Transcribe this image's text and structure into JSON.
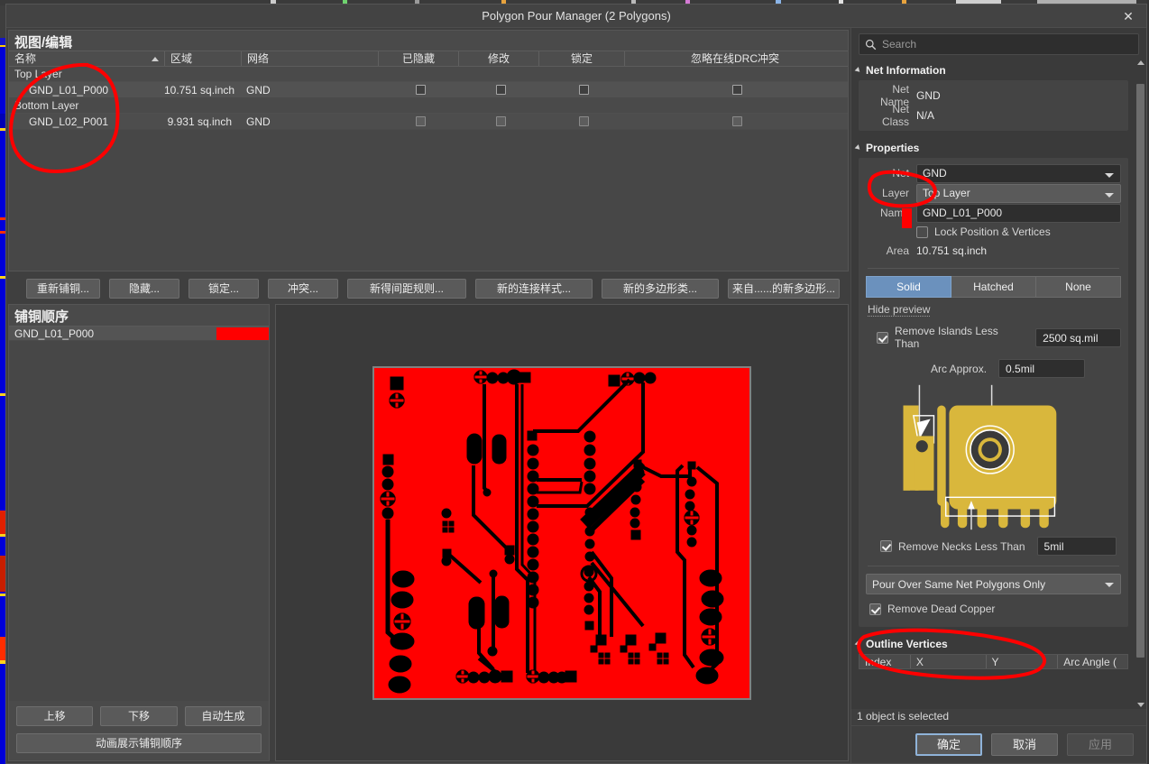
{
  "window": {
    "title": "Polygon Pour Manager (2 Polygons)",
    "close_icon": "close-icon"
  },
  "view_edit": {
    "heading": "视图/编辑",
    "columns": [
      "名称",
      "区域",
      "网络",
      "已隐藏",
      "修改",
      "锁定",
      "忽略在线DRC冲突"
    ],
    "groups": [
      {
        "layer": "Top Layer",
        "rows": [
          {
            "name": "GND_L01_P000",
            "area": "10.751 sq.inch",
            "net": "GND",
            "hidden": false,
            "modified": false,
            "locked": false,
            "ignore_drc": false
          }
        ]
      },
      {
        "layer": "Bottom Layer",
        "rows": [
          {
            "name": "GND_L02_P001",
            "area": "9.931 sq.inch",
            "net": "GND",
            "hidden": false,
            "modified": false,
            "locked": false,
            "ignore_drc": false
          }
        ]
      }
    ],
    "buttons": [
      "重新铺铜...",
      "隐藏...",
      "锁定...",
      "冲突...",
      "新得间距规则...",
      "新的连接样式...",
      "新的多边形类...",
      "来自......的新多边形..."
    ]
  },
  "pour_order": {
    "heading": "铺铜顺序",
    "items": [
      {
        "name": "GND_L01_P000",
        "color": "#ff0000"
      }
    ],
    "buttons": {
      "up": "上移",
      "down": "下移",
      "auto": "自动生成",
      "animate": "动画展示铺铜顺序"
    }
  },
  "preview": {
    "board_color": "#ff0000",
    "trace_color": "#000000",
    "background": "#808080"
  },
  "search": {
    "placeholder": "Search",
    "value": "",
    "icon": "search-icon"
  },
  "net_information": {
    "title": "Net Information",
    "net_name_label": "Net Name",
    "net_name_value": "GND",
    "net_class_label": "Net Class",
    "net_class_value": "N/A"
  },
  "properties": {
    "title": "Properties",
    "net_label": "Net",
    "net_value": "GND",
    "layer_label": "Layer",
    "layer_value": "Top Layer",
    "name_label": "Name",
    "name_value": "GND_L01_P000",
    "lock_label": "Lock Position & Vertices",
    "lock_checked": false,
    "area_label": "Area",
    "area_value": "10.751 sq.inch",
    "fill_modes": [
      "Solid",
      "Hatched",
      "None"
    ],
    "fill_mode_selected": "Solid",
    "hide_preview_label": "Hide preview",
    "remove_islands_label": "Remove Islands Less Than",
    "remove_islands_checked": true,
    "remove_islands_value": "2500 sq.mil",
    "arc_approx_label": "Arc Approx.",
    "arc_approx_value": "0.5mil",
    "remove_necks_label": "Remove Necks Less Than",
    "remove_necks_checked": true,
    "remove_necks_value": "5mil",
    "pour_over_value": "Pour Over Same Net Polygons Only",
    "remove_dead_copper_label": "Remove Dead Copper",
    "remove_dead_copper_checked": true,
    "illustration_color": "#d9b73c"
  },
  "outline_vertices": {
    "title": "Outline Vertices",
    "columns": [
      "Index",
      "X",
      "Y",
      "Arc Angle ("
    ]
  },
  "status": {
    "text": "1 object is selected"
  },
  "footer": {
    "ok": "确定",
    "cancel": "取消",
    "apply": "应用"
  },
  "annotation": {
    "color": "#ff0000"
  }
}
